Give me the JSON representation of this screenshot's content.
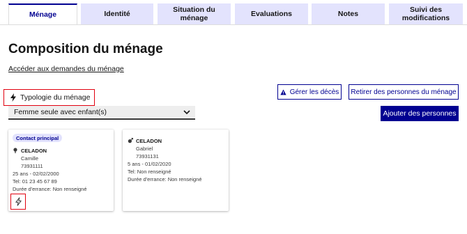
{
  "tabs": [
    {
      "label": "Ménage",
      "active": true
    },
    {
      "label": "Identité",
      "active": false
    },
    {
      "label": "Situation du ménage",
      "active": false
    },
    {
      "label": "Evaluations",
      "active": false
    },
    {
      "label": "Notes",
      "active": false
    },
    {
      "label": "Suivi des modifications",
      "active": false
    }
  ],
  "page": {
    "title": "Composition du ménage",
    "link_demandes": "Accéder aux demandes du ménage"
  },
  "typologie": {
    "label": "Typologie du ménage",
    "icon": "bolt-icon",
    "selected": "Femme seule avec enfant(s)"
  },
  "buttons": {
    "gerer_deces": "Gérer les décès",
    "retirer": "Retirer des personnes du ménage",
    "ajouter": "Ajouter des personnes"
  },
  "persons": [
    {
      "badge": "Contact principal",
      "icon": "female-icon",
      "lastname": "CELADON",
      "firstname": "Camille",
      "id": "73931111",
      "age_birth": "25 ans - 02/02/2000",
      "tel": "Tel: 01 23 45 67 89",
      "errance": "Durée d'errance: Non renseigné"
    },
    {
      "badge": "",
      "icon": "male-icon",
      "lastname": "CELADON",
      "firstname": "Gabriel",
      "id": "73931131",
      "age_birth": "5 ans - 01/02/2020",
      "tel": "Tel: Non renseigné",
      "errance": "Durée d'errance: Non renseigné"
    }
  ],
  "colors": {
    "primary": "#000091",
    "tab_bg": "#e3e3fd",
    "highlight": "#e1000f"
  }
}
